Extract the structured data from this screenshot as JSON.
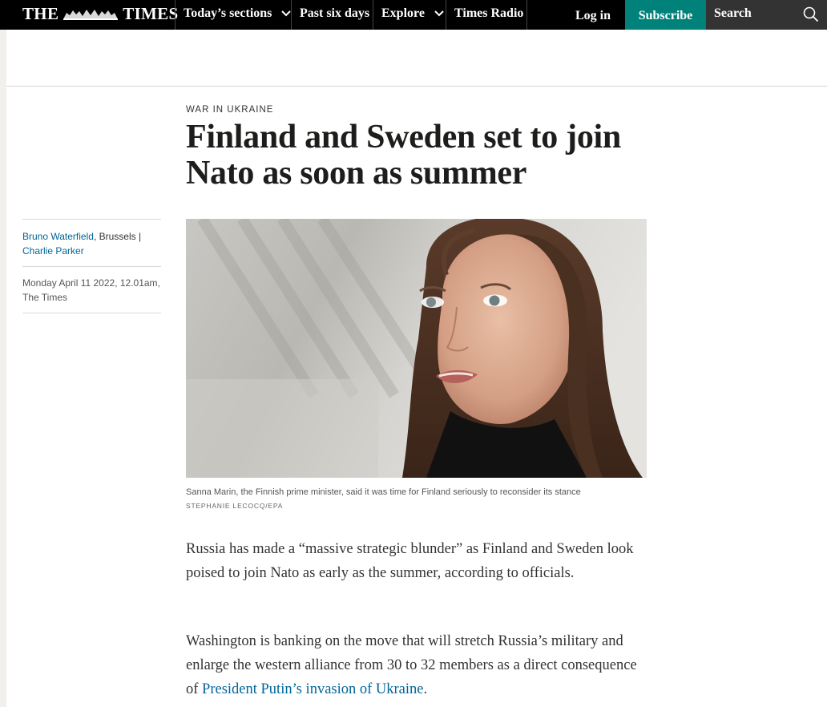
{
  "nav": {
    "logo_left": "THE",
    "logo_right": "TIMES",
    "sections_label": "Today’s sections",
    "past_label": "Past six days",
    "explore_label": "Explore",
    "radio_label": "Times Radio",
    "login_label": "Log in",
    "subscribe_label": "Subscribe",
    "search_label": "Search"
  },
  "article": {
    "kicker": "WAR IN UKRAINE",
    "headline": "Finland and Sweden set to join Nato as soon as summer",
    "byline": {
      "author1": "Bruno Waterfield",
      "location": ", Brussels |",
      "author2": "Charlie Parker",
      "date": "Monday April 11 2022, 12.01am,",
      "publication": "The Times"
    },
    "image": {
      "caption": "Sanna Marin, the Finnish prime minister, said it was time for Finland seriously to reconsider its stance",
      "credit": "STEPHANIE LECOCQ/EPA"
    },
    "paragraphs": [
      {
        "text": "Russia has made a “massive strategic blunder” as Finland and Sweden look poised to join Nato as early as the summer, according to officials."
      },
      {
        "text_before": "Washington is banking on the move that will stretch Russia’s military and enlarge the western alliance from 30 to 32 members as a direct consequence of ",
        "link": "President Putin’s invasion of Ukraine",
        "text_after": "."
      }
    ]
  },
  "colors": {
    "nav_bg": "#000000",
    "subscribe_bg": "#00827b",
    "search_bg": "#333333",
    "link": "#006699"
  }
}
